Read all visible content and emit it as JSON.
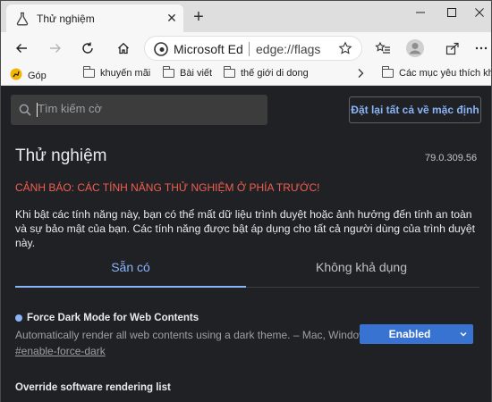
{
  "tab": {
    "title": "Thử nghiệm"
  },
  "toolbar": {
    "site_name": "Microsoft Ed",
    "url": "edge://flags"
  },
  "bookmarks": [
    {
      "label": "Góp"
    },
    {
      "label": "khuyến mãi"
    },
    {
      "label": "Bài viết"
    },
    {
      "label": "thế giới di dong"
    },
    {
      "label": "Các mục yêu thích khác"
    }
  ],
  "page": {
    "search_placeholder": "Tìm kiếm cờ",
    "reset_button": "Đặt lại tất cả về mặc định",
    "title": "Thử nghiệm",
    "version": "79.0.309.56",
    "warning": "CẢNH BÁO: CÁC TÍNH NĂNG THỬ NGHIỆM Ở PHÍA TRƯỚC!",
    "description": "Khi bật các tính năng này, bạn có thể mất dữ liệu trình duyệt hoặc ảnh hưởng đến tính an toàn và sự bảo mật của bạn. Các tính năng được bật áp dụng cho tất cả người dùng của trình duyệt này.",
    "tabs": [
      {
        "label": "Sẵn có",
        "active": true
      },
      {
        "label": "Không khả dụng",
        "active": false
      }
    ],
    "experiments": [
      {
        "title": "Force Dark Mode for Web Contents",
        "description": "Automatically render all web contents using a dark theme. – Mac, Windows",
        "link": "#enable-force-dark",
        "value": "Enabled"
      },
      {
        "title": "Override software rendering list"
      }
    ]
  },
  "colors": {
    "accent": "#8ab4f8",
    "warning": "#f25e52",
    "select_bg": "#3873d1",
    "page_bg": "#202124"
  }
}
